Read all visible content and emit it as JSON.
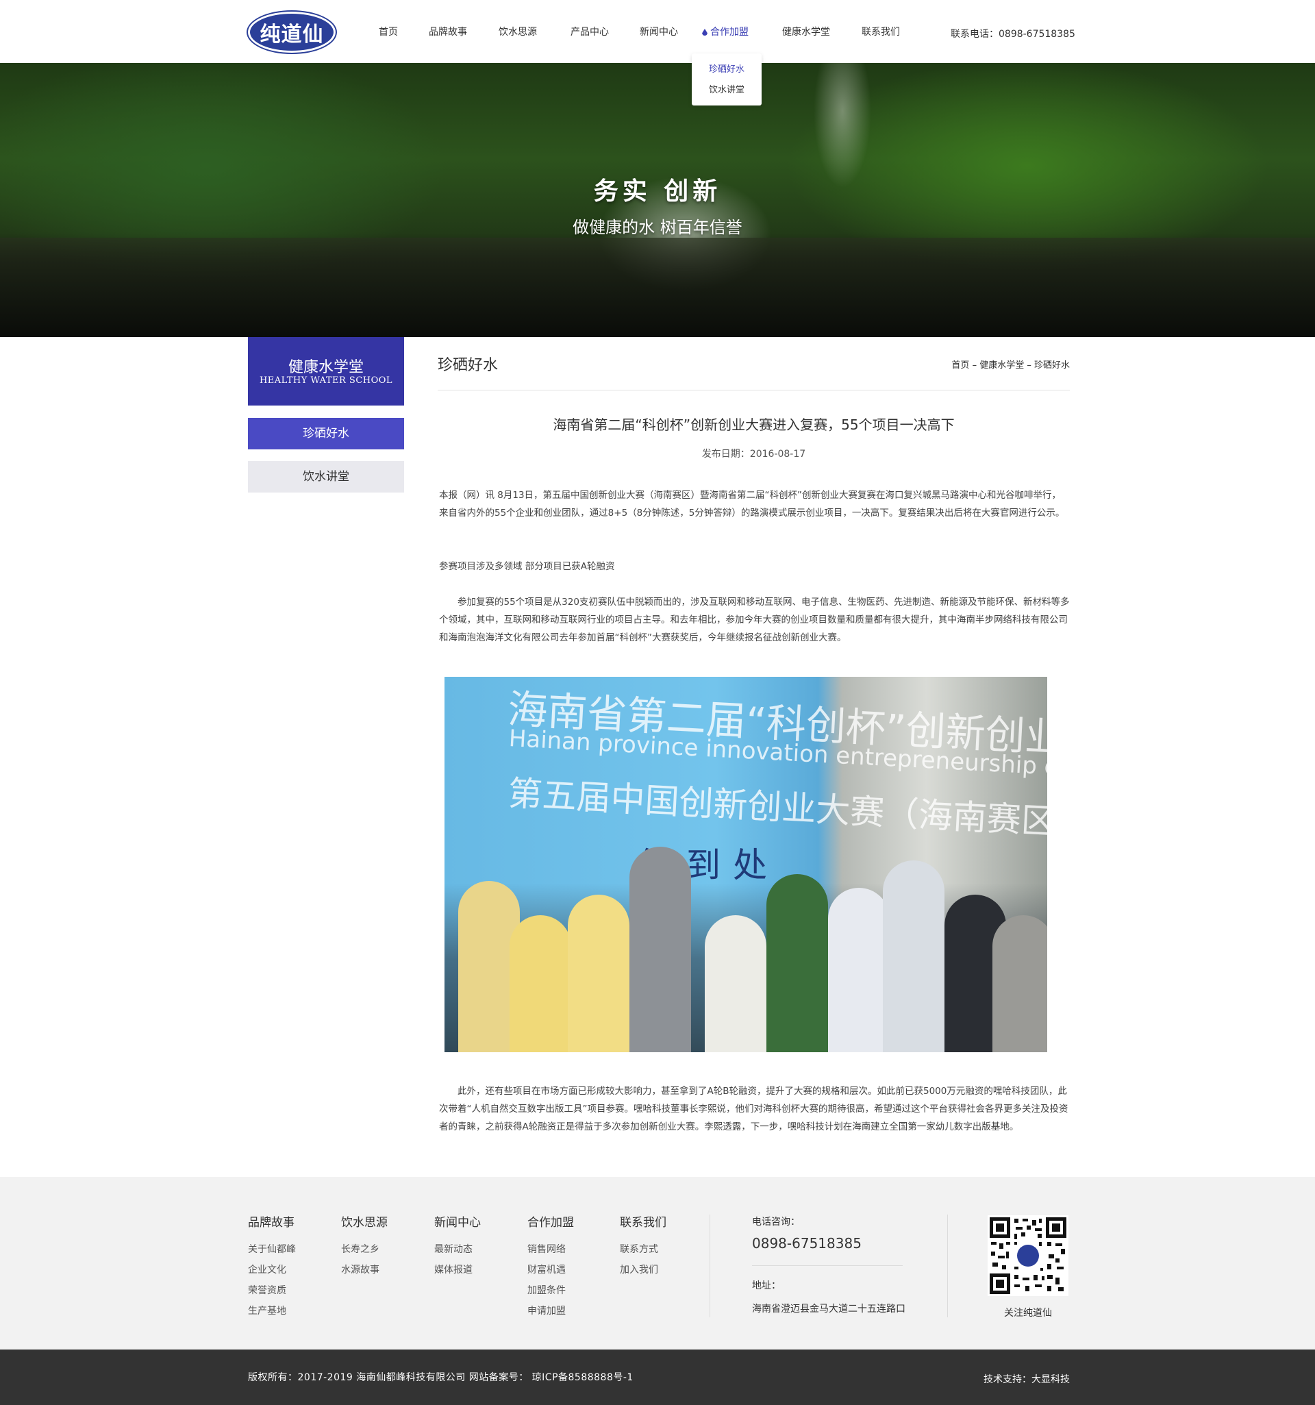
{
  "header": {
    "logo_text": "纯道仙",
    "nav": [
      {
        "label": "首页",
        "active": false
      },
      {
        "label": "品牌故事",
        "active": false
      },
      {
        "label": "饮水思源",
        "active": false
      },
      {
        "label": "产品中心",
        "active": false
      },
      {
        "label": "新闻中心",
        "active": false
      },
      {
        "label": "合作加盟",
        "active": true
      },
      {
        "label": "健康水学堂",
        "active": false
      },
      {
        "label": "联系我们",
        "active": false
      }
    ],
    "phone": "联系电话：0898-67518385",
    "dropdown": [
      {
        "label": "珍硒好水",
        "active": true
      },
      {
        "label": "饮水讲堂",
        "active": false
      }
    ]
  },
  "banner": {
    "title": "务实 创新",
    "subtitle": "做健康的水 树百年信誉"
  },
  "sidebar": {
    "title": "健康水学堂",
    "subtitle": "HEALTHY WATER SCHOOL",
    "items": [
      {
        "label": "珍硒好水",
        "active": true
      },
      {
        "label": "饮水讲堂",
        "active": false
      }
    ]
  },
  "main": {
    "page_title": "珍硒好水",
    "breadcrumb": [
      "首页",
      "健康水学堂",
      "珍硒好水"
    ],
    "breadcrumb_sep": " – ",
    "article": {
      "title": "海南省第二届“科创杯”创新创业大赛进入复赛，55个项目一决高下",
      "date": "发布日期：2016-08-17",
      "para1": "本报（网）讯  8月13日，第五届中国创新创业大赛（海南赛区）暨海南省第二届“科创杯”创新创业大赛复赛在海口复兴城黑马路演中心和光谷咖啡举行，来自省内外的55个企业和创业团队，通过8+5（8分钟陈述，5分钟答辩）的路演模式展示创业项目，一决高下。复赛结果决出后将在大赛官网进行公示。",
      "subheading": "参赛项目涉及多领域 部分项目已获A轮融资",
      "para2": "参加复赛的55个项目是从320支初赛队伍中脱颖而出的，涉及互联网和移动互联网、电子信息、生物医药、先进制造、新能源及节能环保、新材料等多个领域，其中，互联网和移动互联网行业的项目占主导。和去年相比，参加今年大赛的创业项目数量和质量都有很大提升，其中海南半步网络科技有限公司和海南泡泡海洋文化有限公司去年参加首届“科创杯”大赛获奖后，今年继续报名征战创新创业大赛。",
      "photo_text_1": "海南省第二届“科创杯”创新创业大赛",
      "photo_text_2": "Hainan province innovation entrepreneurship competition",
      "photo_text_3": "第五届中国创新创业大赛（海南赛区）",
      "photo_sign": "签到处",
      "para3": "此外，还有些项目在市场方面已形成较大影响力，甚至拿到了A轮B轮融资，提升了大赛的规格和层次。如此前已获5000万元融资的嘿哈科技团队，此次带着“人机自然交互数字出版工具”项目参赛。嘿哈科技董事长李熙说，他们对海科创杯大赛的期待很高，希望通过这个平台获得社会各界更多关注及投资者的青睐，之前获得A轮融资正是得益于多次参加创新创业大赛。李熙透露，下一步，嘿哈科技计划在海南建立全国第一家幼儿数字出版基地。"
    }
  },
  "footer": {
    "columns": [
      {
        "title": "品牌故事",
        "links": [
          "关于仙都峰",
          "企业文化",
          "荣誉资质",
          "生产基地"
        ]
      },
      {
        "title": "饮水思源",
        "links": [
          "长寿之乡",
          "水源故事"
        ]
      },
      {
        "title": "新闻中心",
        "links": [
          "最新动态",
          "媒体报道"
        ]
      },
      {
        "title": "合作加盟",
        "links": [
          "销售网络",
          "财富机遇",
          "加盟条件",
          "申请加盟"
        ]
      },
      {
        "title": "联系我们",
        "links": [
          "联系方式",
          "加入我们"
        ]
      }
    ],
    "phone_label": "电话咨询：",
    "phone": "0898-67518385",
    "address_label": "地址：",
    "address": "海南省澄迈县金马大道二十五连路口",
    "qr_center": "纯道仙",
    "qr_label": "关注纯道仙",
    "copyright": "版权所有：2017-2019 海南仙都峰科技有限公司   网站备案号： 琼ICP备8588888号-1",
    "support": "技术支持：大显科技"
  },
  "colors": {
    "brand": "#3535a4",
    "accent": "#4a4ac4",
    "nav_active": "#3b3fb4",
    "footer_bg": "#f2f2f2",
    "bottom_bar": "#333333"
  }
}
